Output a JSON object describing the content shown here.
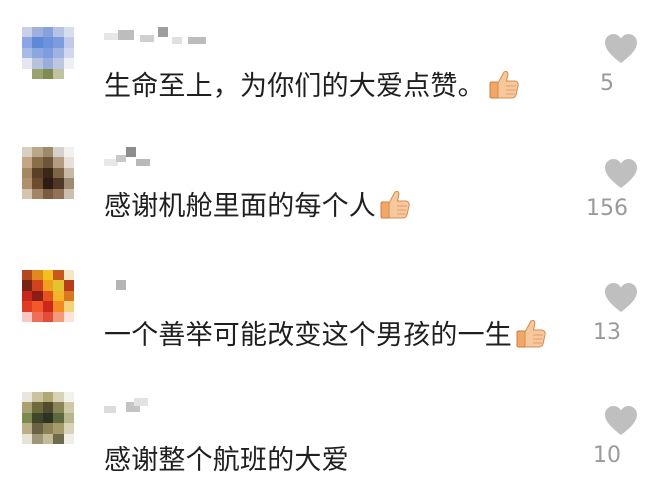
{
  "comments": [
    {
      "text": "生命至上，为你们的大爱点赞。",
      "has_thumb": true,
      "likes": "5",
      "avatar_colors": [
        "#c9cfe6",
        "#9fb0de",
        "#86a2da",
        "#b6c2e6",
        "#d8dcef",
        "#8aa6e6",
        "#5e88d8",
        "#6d92dc",
        "#7b9de0",
        "#c1cbe9",
        "#a8bbe6",
        "#8ca6e0",
        "#7f9ce0",
        "#9eb2e4",
        "#d1d7ee",
        "#e4e7f1",
        "#b7c2df",
        "#99aedb",
        "#bdc7e2",
        "#eef0f5",
        "#ffffff",
        "#9aa26f",
        "#7f8b52",
        "#bfc49e",
        "#ffffff"
      ]
    },
    {
      "text": "感谢机舱里面的每个人",
      "has_thumb": true,
      "likes": "156",
      "avatar_colors": [
        "#d8cfc2",
        "#b9a789",
        "#9d8a68",
        "#d6d2cb",
        "#f2f1ef",
        "#c4a684",
        "#8a6d49",
        "#6e553a",
        "#b39c81",
        "#e6e0d8",
        "#a68762",
        "#5a4026",
        "#3a2717",
        "#7f6445",
        "#c8b9a6",
        "#b0916d",
        "#6b4c2e",
        "#2c1d12",
        "#4e3825",
        "#9f8a74",
        "#d5c5b0",
        "#a38466",
        "#7b5b3d",
        "#8f7257",
        "#cdbfae"
      ]
    },
    {
      "text": "一个善举可能改变这个男孩的一生",
      "has_thumb": true,
      "likes": "13",
      "avatar_colors": [
        "#b5471f",
        "#e08a1e",
        "#f2c21c",
        "#c9561d",
        "#f4e7c8",
        "#7a2416",
        "#d4411d",
        "#f0a01c",
        "#e2c330",
        "#b63c1b",
        "#c42a1b",
        "#8b1d14",
        "#e6521f",
        "#f5b52a",
        "#d9781f",
        "#e23b23",
        "#f05a2a",
        "#c9281a",
        "#f28a24",
        "#f6d27a",
        "#f7c9c2",
        "#ee6e5a",
        "#e54b39",
        "#f39a7a",
        "#fbe3dc"
      ]
    },
    {
      "text": "感谢整个航班的大爱",
      "has_thumb": false,
      "likes": "10",
      "avatar_colors": [
        "#e8e6dd",
        "#c9c3a0",
        "#b0a973",
        "#d7d2b8",
        "#f3f2ec",
        "#a9a172",
        "#6f6a3e",
        "#4f4b2c",
        "#8a8458",
        "#cfc9a8",
        "#7d8a4f",
        "#3e452b",
        "#2f3321",
        "#5f6940",
        "#b5b58f",
        "#b9b08a",
        "#6b6144",
        "#8c8456",
        "#a49a6b",
        "#d8d3b9",
        "#e7e4d6",
        "#9e9676",
        "#c4bc98",
        "#6e6a4d",
        "#efede4"
      ]
    }
  ],
  "colors": {
    "text": "#1f1f1f",
    "count": "#9a9a9a",
    "heart": "#bfbfbf",
    "username_block": "#bdbdbd"
  }
}
